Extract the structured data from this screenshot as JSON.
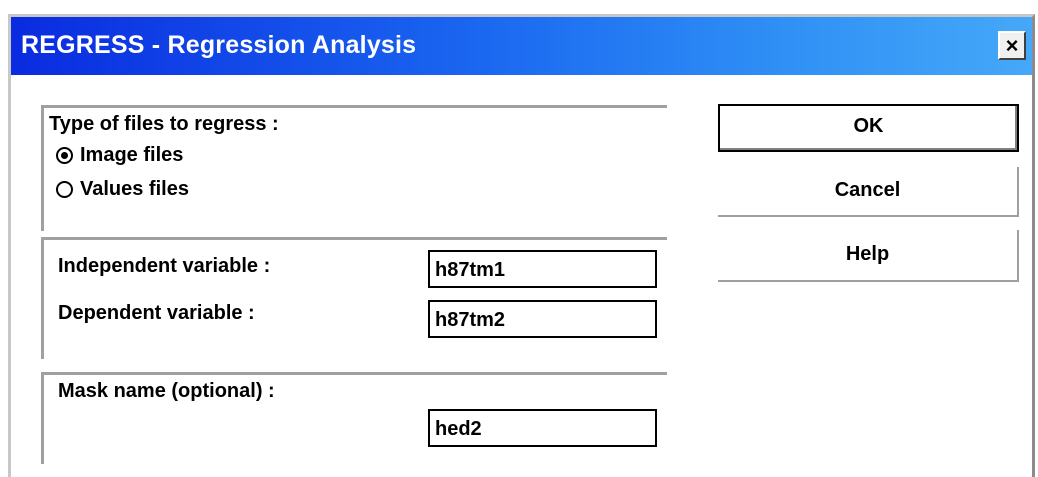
{
  "window": {
    "title": "REGRESS - Regression Analysis",
    "close_glyph": "×"
  },
  "file_type_group": {
    "label": "Type of files to regress :",
    "options": [
      {
        "label": "Image files",
        "selected": true
      },
      {
        "label": "Values files",
        "selected": false
      }
    ]
  },
  "variables_group": {
    "independent_label": "Independent variable :",
    "independent_value": "h87tm1",
    "dependent_label": "Dependent variable :",
    "dependent_value": "h87tm2"
  },
  "mask_group": {
    "label": "Mask name (optional) :",
    "value": "hed2"
  },
  "buttons": {
    "ok": "OK",
    "cancel": "Cancel",
    "help": "Help"
  }
}
